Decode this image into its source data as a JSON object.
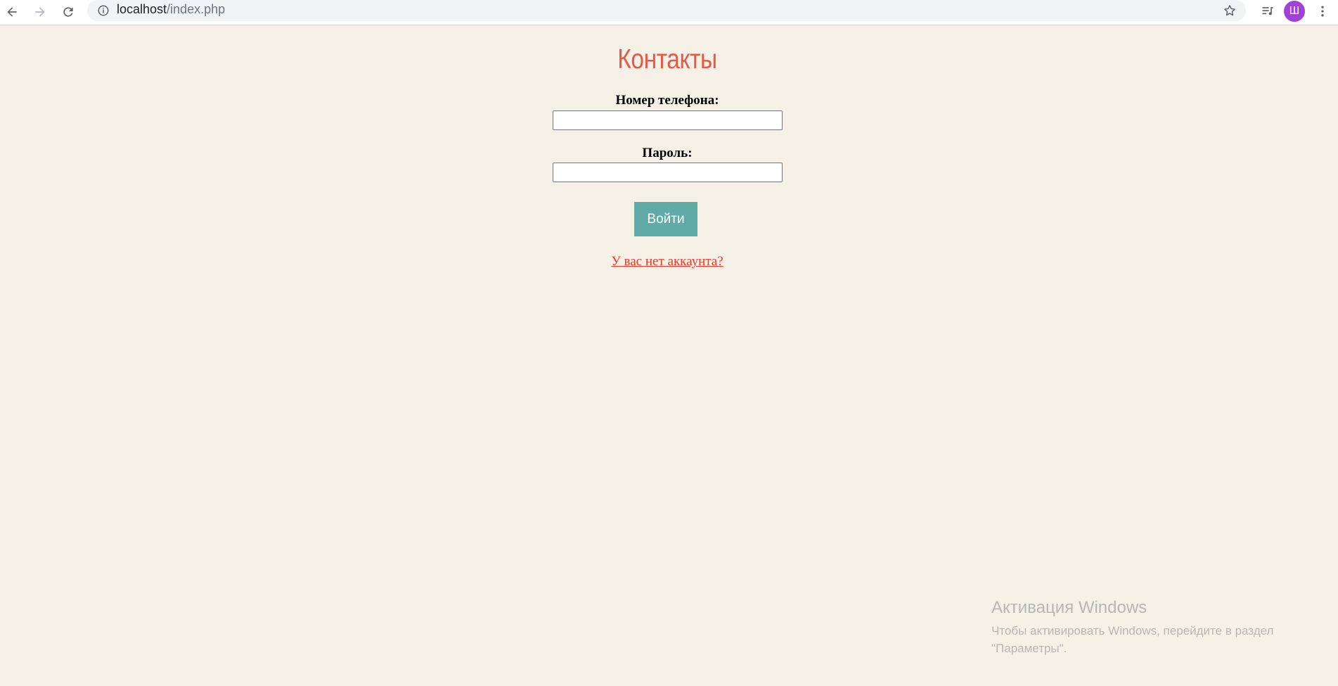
{
  "browser": {
    "url_host": "localhost",
    "url_path": "/index.php",
    "avatar_letter": "Ш",
    "icons": [
      "back-arrow-icon",
      "forward-arrow-icon",
      "reload-icon",
      "info-icon",
      "star-icon",
      "media-queue-icon",
      "menu-dots-icon"
    ]
  },
  "page": {
    "title": "Контакты",
    "phone_label": "Номер телефона:",
    "phone_value": "",
    "password_label": "Пароль:",
    "password_value": "",
    "login_button": "Войти",
    "register_link": "У вас нет аккаунта?"
  },
  "watermark": {
    "title": "Активация Windows",
    "text": "Чтобы активировать Windows, перейдите в раздел \"Параметры\"."
  },
  "colors": {
    "background": "#f6f1e7",
    "title": "#e25a48",
    "button": "#60aaa8",
    "link": "#e53a2b",
    "avatar": "#a142d4"
  }
}
